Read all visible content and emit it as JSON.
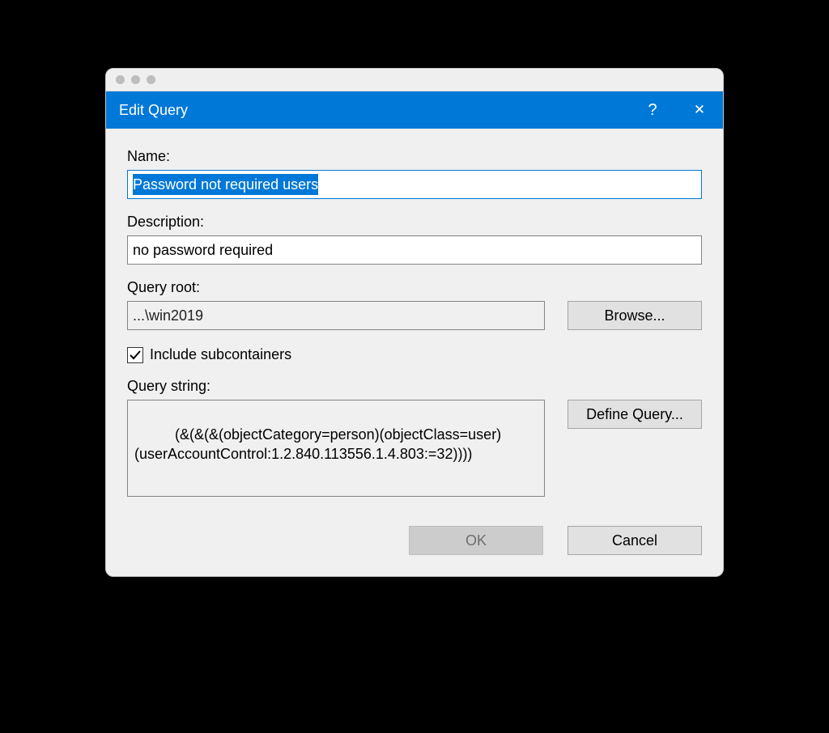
{
  "dialog": {
    "title": "Edit Query",
    "labels": {
      "name": "Name:",
      "description": "Description:",
      "query_root": "Query root:",
      "query_string": "Query string:",
      "include_subcontainers": "Include subcontainers"
    },
    "fields": {
      "name_value": "Password not required users",
      "description_value": "no password required",
      "query_root_value": "...\\win2019",
      "query_string_value": "(&(&(&(objectCategory=person)(objectClass=user)(userAccountControl:1.2.840.113556.1.4.803:=32))))"
    },
    "checkbox": {
      "include_subcontainers_checked": true
    },
    "buttons": {
      "browse": "Browse...",
      "define_query": "Define Query...",
      "ok": "OK",
      "cancel": "Cancel"
    },
    "titlebar": {
      "help_glyph": "?",
      "close_glyph": "✕"
    },
    "state": {
      "ok_enabled": false,
      "name_selected": true
    }
  }
}
